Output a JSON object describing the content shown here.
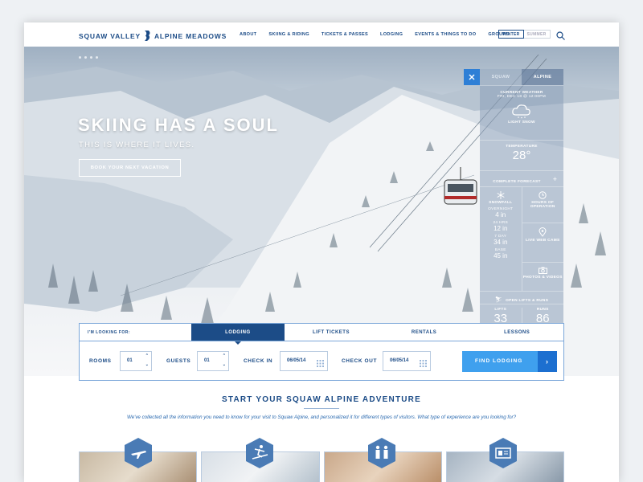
{
  "header": {
    "brand_left": "SQUAW VALLEY",
    "brand_right": "ALPINE MEADOWS",
    "nav": [
      "ABOUT",
      "SKIING & RIDING",
      "TICKETS & PASSES",
      "LODGING",
      "EVENTS & THINGS TO DO",
      "GROUPS"
    ],
    "season_winter": "WINTER",
    "season_summer": "SUMMER",
    "search_icon": "search-icon"
  },
  "hero": {
    "headline": "SKIING HAS A SOUL",
    "subline": "THIS IS WHERE IT LIVES.",
    "cta": "BOOK YOUR NEXT VACATION"
  },
  "weather": {
    "tab_squaw": "SQUAW",
    "tab_alpine": "ALPINE",
    "current_label": "CURRENT WEATHER",
    "current_date": "FRI, DEC 18 @ 12:00PM",
    "condition": "LIGHT SNOW",
    "temp_label": "TEMPERATURE",
    "temp_value": "28°",
    "forecast": "COMPLETE FORECAST",
    "snowfall_label": "SNOWFALL",
    "overnight_label": "OVERNIGHT",
    "overnight_value": "4 in",
    "h24_label": "24 HRS",
    "h24_value": "12 in",
    "d7_label": "7 DAY",
    "d7_value": "34 in",
    "base_label": "BASE",
    "base_value": "45 in",
    "hours_label": "HOURS OF OPERATION",
    "webcams_label": "LIVE WEB CAMS",
    "photos_label": "PHOTOS & VIDEOS",
    "open_label": "OPEN LIFTS & RUNS",
    "lifts_label": "LIFTS",
    "lifts_value": "33",
    "runs_label": "RUNS",
    "runs_value": "86",
    "colors": {
      "close": "#2e7fd6"
    }
  },
  "booking": {
    "prompt": "I'M LOOKING FOR:",
    "tabs": [
      "LODGING",
      "LIFT TICKETS",
      "RENTALS",
      "LESSONS"
    ],
    "rooms_label": "ROOMS",
    "rooms_value": "01",
    "guests_label": "GUESTS",
    "guests_value": "01",
    "checkin_label": "CHECK IN",
    "checkin_value": "06/05/14",
    "checkout_label": "CHECK OUT",
    "checkout_value": "06/05/14",
    "find_label": "FIND LODGING",
    "find_arrow": "›",
    "colors": {
      "active": "#1c4c87",
      "find": "#3fa0ee",
      "find_arrow": "#1c6fd0"
    }
  },
  "adventure": {
    "title": "START YOUR SQUAW ALPINE ADVENTURE",
    "intro": "We've collected all the information you need to know for your visit to Squaw Alpine, and personalized it for different types of visitors. What type of experience are you looking for?",
    "card_icons": [
      "plane-icon",
      "skier-icon",
      "family-icon",
      "ticket-icon"
    ]
  }
}
